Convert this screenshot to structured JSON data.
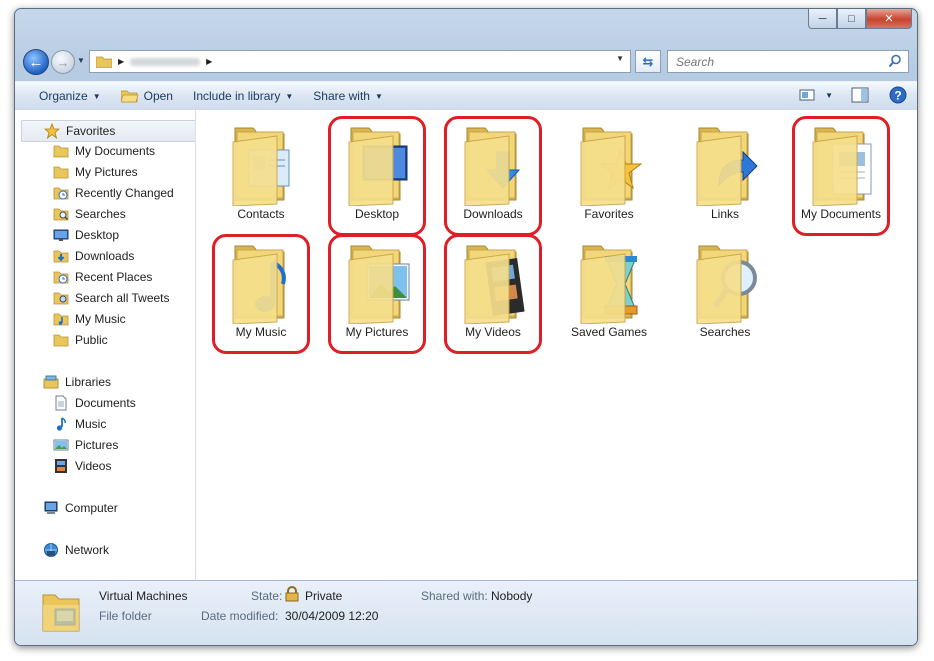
{
  "window": {
    "caption_buttons": [
      "minimize-icon",
      "maximize-icon",
      "close-icon"
    ]
  },
  "address_bar": {
    "breadcrumb_text": "Public",
    "search_placeholder": "Search"
  },
  "toolbar": {
    "organize": "Organize",
    "open": "Open",
    "include_in_library": "Include in library",
    "share_with": "Share with"
  },
  "nav": {
    "favorites": "Favorites",
    "favorites_items": [
      "My Documents",
      "My Pictures",
      "Recently Changed",
      "Searches",
      "Desktop",
      "Downloads",
      "Recent Places",
      "Search all Tweets",
      "My Music",
      "Public"
    ],
    "libraries": "Libraries",
    "libraries_items": [
      "Documents",
      "Music",
      "Pictures",
      "Videos"
    ],
    "computer": "Computer",
    "network": "Network"
  },
  "folders": [
    {
      "label": "Contacts",
      "icon": "contacts-icon",
      "highlighted": false
    },
    {
      "label": "Desktop",
      "icon": "desktop-icon",
      "highlighted": true
    },
    {
      "label": "Downloads",
      "icon": "download-arrow-icon",
      "highlighted": true
    },
    {
      "label": "Favorites",
      "icon": "star-icon",
      "highlighted": false
    },
    {
      "label": "Links",
      "icon": "link-arrow-icon",
      "highlighted": false
    },
    {
      "label": "My Documents",
      "icon": "documents-icon",
      "highlighted": true
    },
    {
      "label": "My Music",
      "icon": "music-note-icon",
      "highlighted": true
    },
    {
      "label": "My Pictures",
      "icon": "pictures-icon",
      "highlighted": true
    },
    {
      "label": "My Videos",
      "icon": "film-icon",
      "highlighted": true
    },
    {
      "label": "Saved Games",
      "icon": "hourglass-icon",
      "highlighted": false
    },
    {
      "label": "Searches",
      "icon": "magnifier-icon",
      "highlighted": false
    }
  ],
  "details": {
    "name": "Virtual Machines",
    "type": "File folder",
    "state_label": "State:",
    "state_value": "Private",
    "modified_label": "Date modified:",
    "modified_value": "30/04/2009 12:20",
    "shared_label": "Shared with:",
    "shared_value": "Nobody"
  },
  "colors": {
    "highlight_red": "#e01e26",
    "folder_yellow": "#f2d77a"
  }
}
